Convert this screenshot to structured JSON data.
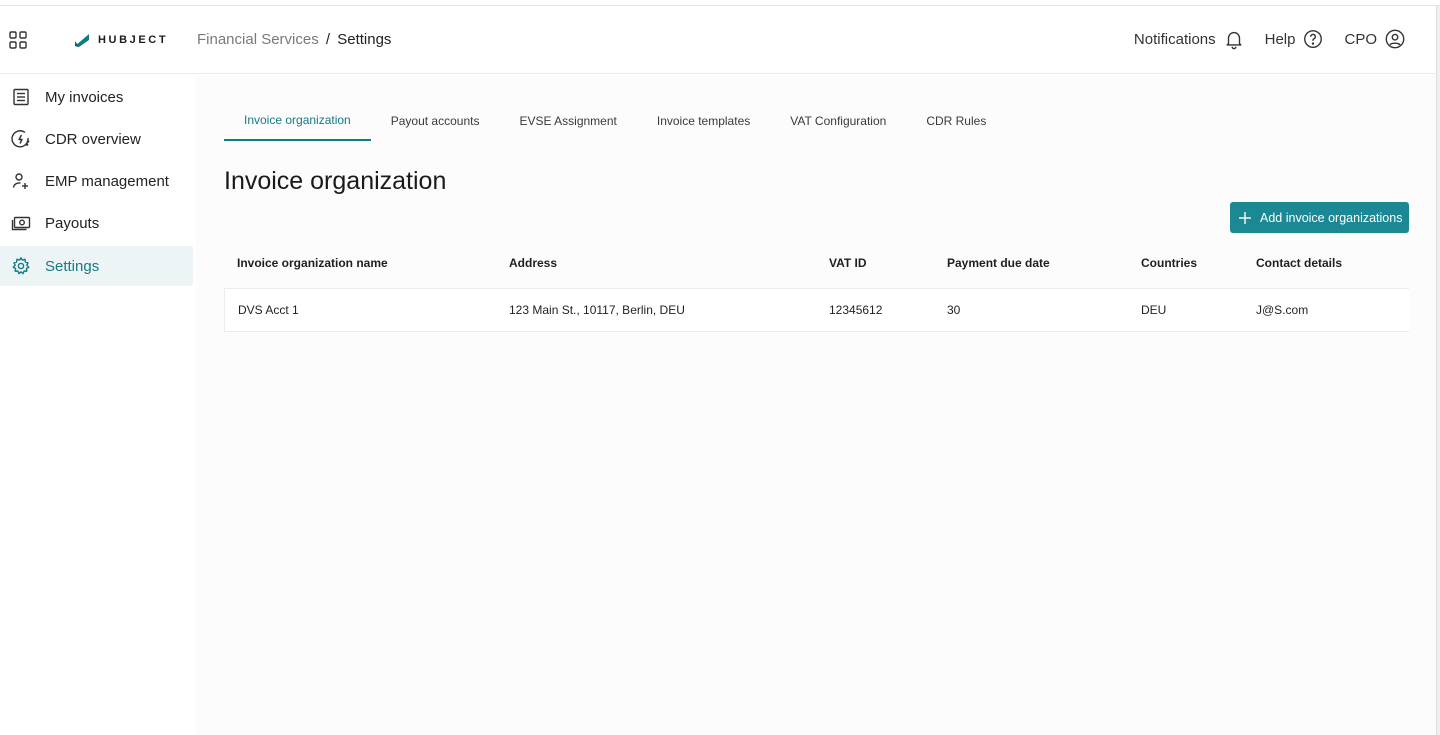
{
  "header": {
    "logo_text": "HUBJECT",
    "breadcrumb": {
      "parent": "Financial Services",
      "separator": "/",
      "current": "Settings"
    },
    "notifications_label": "Notifications",
    "help_label": "Help",
    "user_label": "CPO"
  },
  "sidebar": {
    "items": [
      {
        "label": "My invoices",
        "icon": "document-list-icon"
      },
      {
        "label": "CDR overview",
        "icon": "charging-gauge-icon"
      },
      {
        "label": "EMP management",
        "icon": "person-add-icon"
      },
      {
        "label": "Payouts",
        "icon": "money-icon"
      },
      {
        "label": "Settings",
        "icon": "gear-icon",
        "active": true
      }
    ]
  },
  "tabs": [
    {
      "label": "Invoice organization",
      "active": true
    },
    {
      "label": "Payout accounts"
    },
    {
      "label": "EVSE Assignment"
    },
    {
      "label": "Invoice templates"
    },
    {
      "label": "VAT Configuration"
    },
    {
      "label": "CDR Rules"
    }
  ],
  "page": {
    "title": "Invoice organization",
    "add_button_label": "Add invoice organizations"
  },
  "table": {
    "columns": [
      "Invoice organization name",
      "Address",
      "VAT ID",
      "Payment due date",
      "Countries",
      "Contact details"
    ],
    "rows": [
      [
        "DVS Acct 1",
        "123 Main St., 10117, Berlin, DEU",
        "12345612",
        "30",
        "DEU",
        "J@S.com"
      ]
    ]
  },
  "colors": {
    "accent": "#137b85",
    "button_bg": "#1b8894",
    "active_nav_bg": "#edf4f5"
  }
}
